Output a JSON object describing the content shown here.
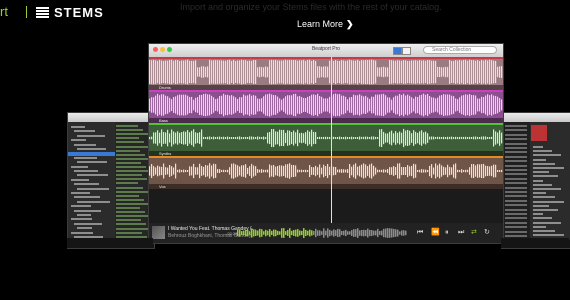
{
  "header": {
    "brand_partial": "rt",
    "stems_logo_text": "STEMS",
    "subtitle": "Import and organize your Stems files with the rest of your catalog.",
    "learn_more_label": "Learn More",
    "learn_more_chevron": "❯"
  },
  "main_window": {
    "title": "Beatport Pro",
    "search_placeholder": "Search Collection",
    "tracks": [
      {
        "name": "Drums",
        "color": "#c73a4a",
        "bg": "#9a7b81",
        "wave": "#f0dede"
      },
      {
        "name": "Bass",
        "color": "#d13fc0",
        "bg": "#8a4f8e",
        "wave": "#e8d2ec"
      },
      {
        "name": "Synths",
        "color": "#4fc435",
        "bg": "#3e5e3a",
        "wave": "#d7efd1"
      },
      {
        "name": "Vox",
        "color": "#e88a24",
        "bg": "#6e5548",
        "wave": "#f0e0d2"
      }
    ],
    "player": {
      "track_title": "I Wanted You Feat. Thomas Gandey (…",
      "artist": "Behrouz Boghkhani, Thomas Gandey",
      "time_elapsed": "-02:28"
    }
  },
  "colors": {
    "accent_green": "#9acd32",
    "playhead": "#e7ff3b",
    "selection_blue": "#3a78d6"
  },
  "icons": {
    "rewind": "⏪",
    "prev": "⏮",
    "pause": "⏸",
    "next": "⏭",
    "shuffle": "⇄",
    "repeat": "↻",
    "volume": "♫"
  }
}
